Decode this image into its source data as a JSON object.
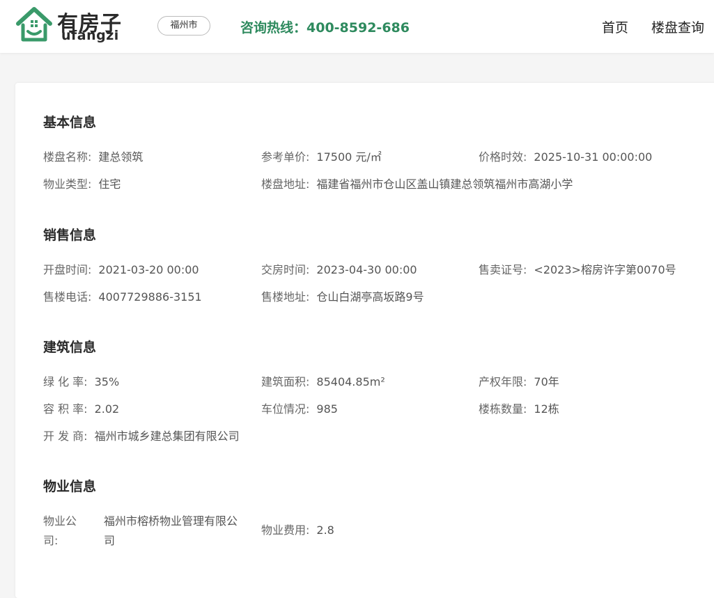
{
  "header": {
    "logo_cn": "有房子",
    "logo_en": "ufangzi",
    "city": "福州市",
    "hotline": "咨询热线：400-8592-686",
    "nav": [
      "首页",
      "楼盘查询"
    ]
  },
  "colors": {
    "brand_green": "#2e8a5e",
    "logo_green": "#3a9a6a"
  },
  "sections": {
    "basic": {
      "title": "基本信息",
      "name_label": "楼盘名称:",
      "name_value": "建总领筑",
      "price_label": "参考单价:",
      "price_value": "17500 元/㎡",
      "price_time_label": "价格时效:",
      "price_time_value": "2025-10-31 00:00:00",
      "type_label": "物业类型:",
      "type_value": "住宅",
      "address_label": "楼盘地址:",
      "address_value": "福建省福州市仓山区盖山镇建总领筑福州市高湖小学"
    },
    "sales": {
      "title": "销售信息",
      "open_label": "开盘时间:",
      "open_value": "2021-03-20 00:00",
      "deliver_label": "交房时间:",
      "deliver_value": "2023-04-30 00:00",
      "permit_label": "售卖证号:",
      "permit_value": "<2023>榕房许字第0070号",
      "phone_label": "售楼电话:",
      "phone_value": "4007729886-3151",
      "office_label": "售楼地址:",
      "office_value": "仓山白湖亭高坂路9号"
    },
    "building": {
      "title": "建筑信息",
      "green_label": "绿 化 率:",
      "green_value": "35%",
      "area_label": "建筑面积:",
      "area_value": "85404.85m²",
      "term_label": "产权年限:",
      "term_value": "70年",
      "far_label": "容 积 率:",
      "far_value": "2.02",
      "parking_label": "车位情况:",
      "parking_value": "985",
      "bldg_count_label": "楼栋数量:",
      "bldg_count_value": "12栋",
      "developer_label": "开 发 商:",
      "developer_value": "福州市城乡建总集团有限公司"
    },
    "property": {
      "title": "物业信息",
      "company_label_1": "物业公",
      "company_label_2": "司:",
      "company_value_1": "福州市榕桥物业管理有限公",
      "company_value_2": "司",
      "fee_label": "物业费用:",
      "fee_value": "2.8"
    }
  }
}
